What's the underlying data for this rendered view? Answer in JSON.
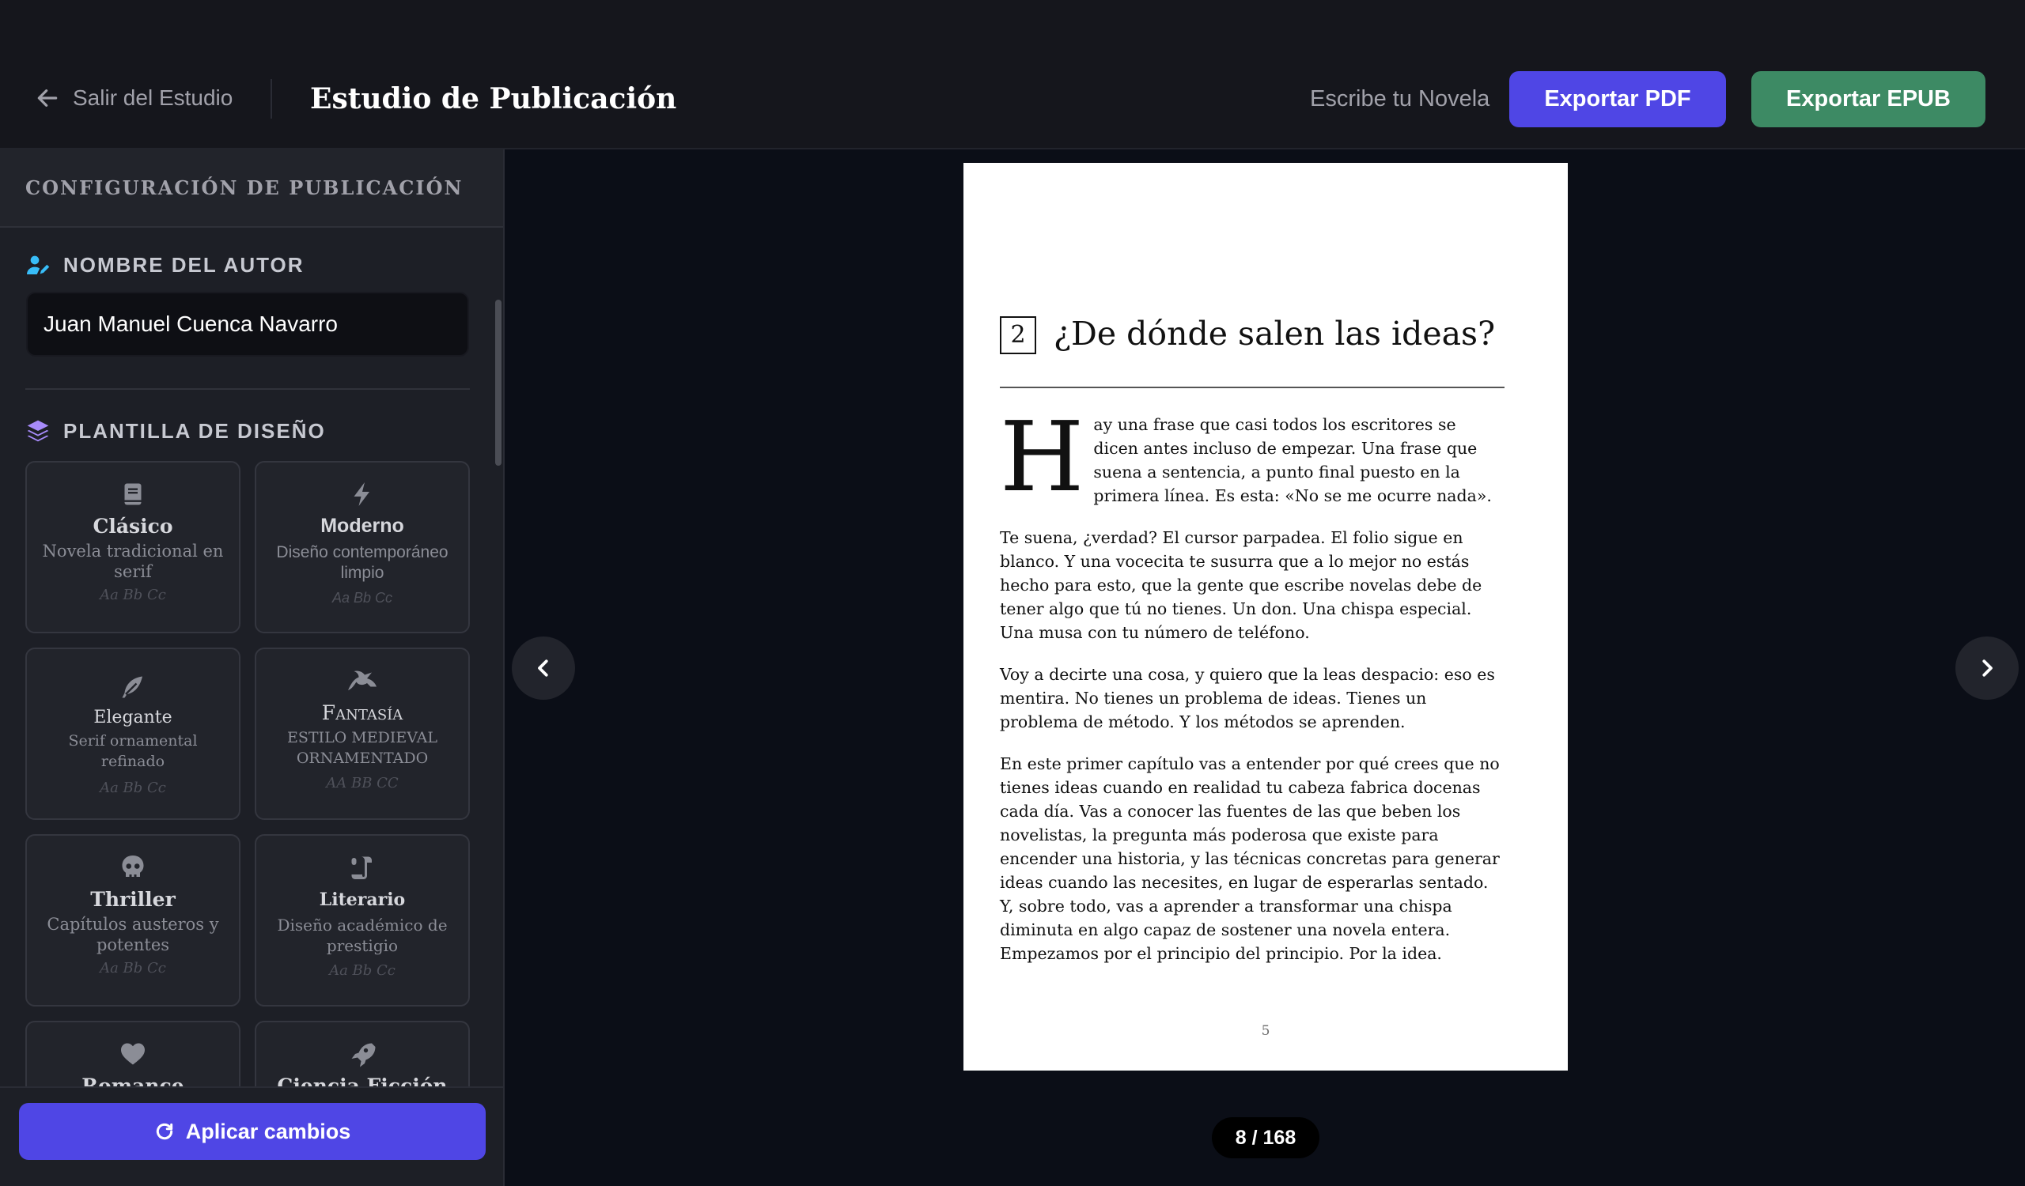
{
  "header": {
    "exit_label": "Salir del Estudio",
    "title": "Estudio de Publicación",
    "write_link": "Escribe tu Novela",
    "export_pdf": "Exportar PDF",
    "export_epub": "Exportar EPUB"
  },
  "sidebar": {
    "heading": "CONFIGURACIÓN DE PUBLICACIÓN",
    "author_label": "NOMBRE DEL AUTOR",
    "author_value": "Juan Manuel Cuenca Navarro",
    "template_label": "PLANTILLA DE DISEÑO",
    "templates": [
      {
        "name": "Clásico",
        "desc": "Novela tradicional en serif",
        "sample": "Aa Bb Cc",
        "icon": "book-icon"
      },
      {
        "name": "Moderno",
        "desc": "Diseño contemporáneo limpio",
        "sample": "Aa Bb Cc",
        "icon": "bolt-icon"
      },
      {
        "name": "Elegante",
        "desc": "Serif ornamental refinado",
        "sample": "Aa Bb Cc",
        "icon": "feather-icon"
      },
      {
        "name": "Fantasía",
        "desc": "Estilo medieval ornamentado",
        "sample": "Aa Bb Cc",
        "icon": "dragon-icon"
      },
      {
        "name": "Thriller",
        "desc": "Capítulos austeros y potentes",
        "sample": "Aa Bb Cc",
        "icon": "skull-icon"
      },
      {
        "name": "Literario",
        "desc": "Diseño académico de prestigio",
        "sample": "Aa Bb Cc",
        "icon": "scroll-icon"
      },
      {
        "name": "Romance",
        "icon": "heart-icon"
      },
      {
        "name": "Ciencia Ficción",
        "icon": "rocket-icon"
      }
    ],
    "apply_label": "Aplicar cambios"
  },
  "preview": {
    "chapter_number": "2",
    "chapter_title": "¿De dónde salen las ideas?",
    "drop_cap": "H",
    "paragraphs": [
      "ay una frase que casi todos los escritores se dicen antes incluso de empezar. Una frase que suena a sentencia, a punto final puesto en la primera línea. Es esta: «No se me ocurre nada».",
      "Te suena, ¿verdad? El cursor parpadea. El folio sigue en blanco. Y una vocecita te susurra que a lo mejor no estás hecho para esto, que la gente que escribe novelas debe de tener algo que tú no tienes. Un don. Una chispa especial. Una musa con tu número de teléfono.",
      "Voy a decirte una cosa, y quiero que la leas despacio: eso es mentira. No tienes un problema de ideas. Tienes un problema de método. Y los métodos se aprenden.",
      "En este primer capítulo vas a entender por qué crees que no tienes ideas cuando en realidad tu cabeza fabrica docenas cada día. Vas a conocer las fuentes de las que beben los novelistas, la pregunta más poderosa que existe para encender una historia, y las técnicas concretas para generar ideas cuando las necesites, en lugar de esperarlas sentado. Y, sobre todo, vas a aprender a transformar una chispa diminuta en algo capaz de sostener una novela entera. Empezamos por el principio del principio. Por la idea."
    ],
    "page_number": "5",
    "counter": "8 / 168"
  },
  "colors": {
    "accent": "#4f46e5",
    "epub": "#3d8a64",
    "background": "#0b0e17",
    "author_icon": "#38bdf8",
    "template_icon": "#a78bfa"
  }
}
